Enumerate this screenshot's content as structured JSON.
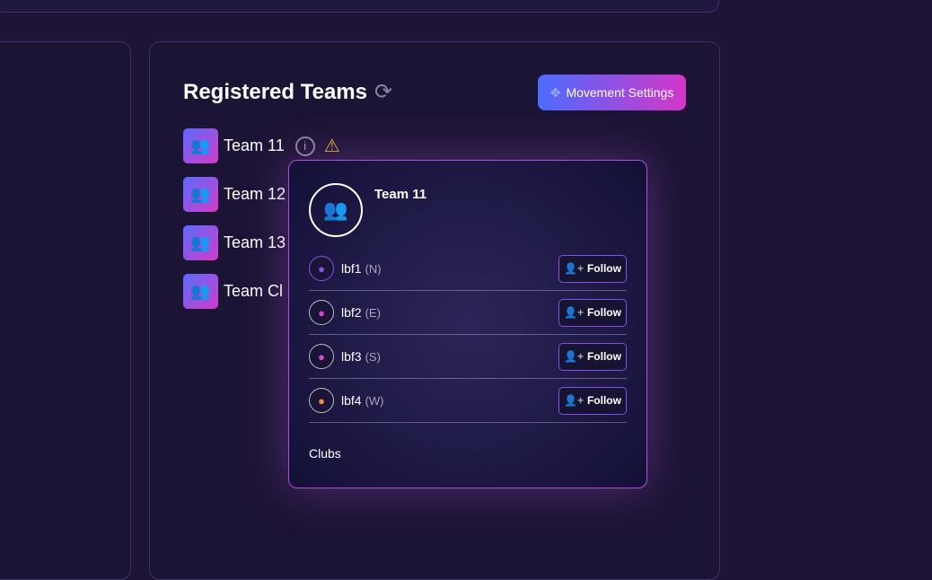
{
  "header": {
    "title": "Registered Teams",
    "refresh_icon": "refresh-icon",
    "movement_settings": "Movement Settings"
  },
  "teams": [
    {
      "name": "Team 11"
    },
    {
      "name": "Team 12"
    },
    {
      "name": "Team 13"
    },
    {
      "name": "Team Cl"
    }
  ],
  "popover": {
    "team_name": "Team 11",
    "members": [
      {
        "name": "lbf1",
        "dir": "(N)",
        "follow": "Follow",
        "color": "#8a4ee8"
      },
      {
        "name": "lbf2",
        "dir": "(E)",
        "follow": "Follow",
        "color": "#e040c0"
      },
      {
        "name": "lbf3",
        "dir": "(S)",
        "follow": "Follow",
        "color": "#d050d0"
      },
      {
        "name": "lbf4",
        "dir": "(W)",
        "follow": "Follow",
        "color": "#f08a30"
      }
    ],
    "clubs_label": "Clubs"
  },
  "colors": {
    "accent_start": "#4a6cff",
    "accent_end": "#d436c8",
    "warning": "#e0b520"
  }
}
